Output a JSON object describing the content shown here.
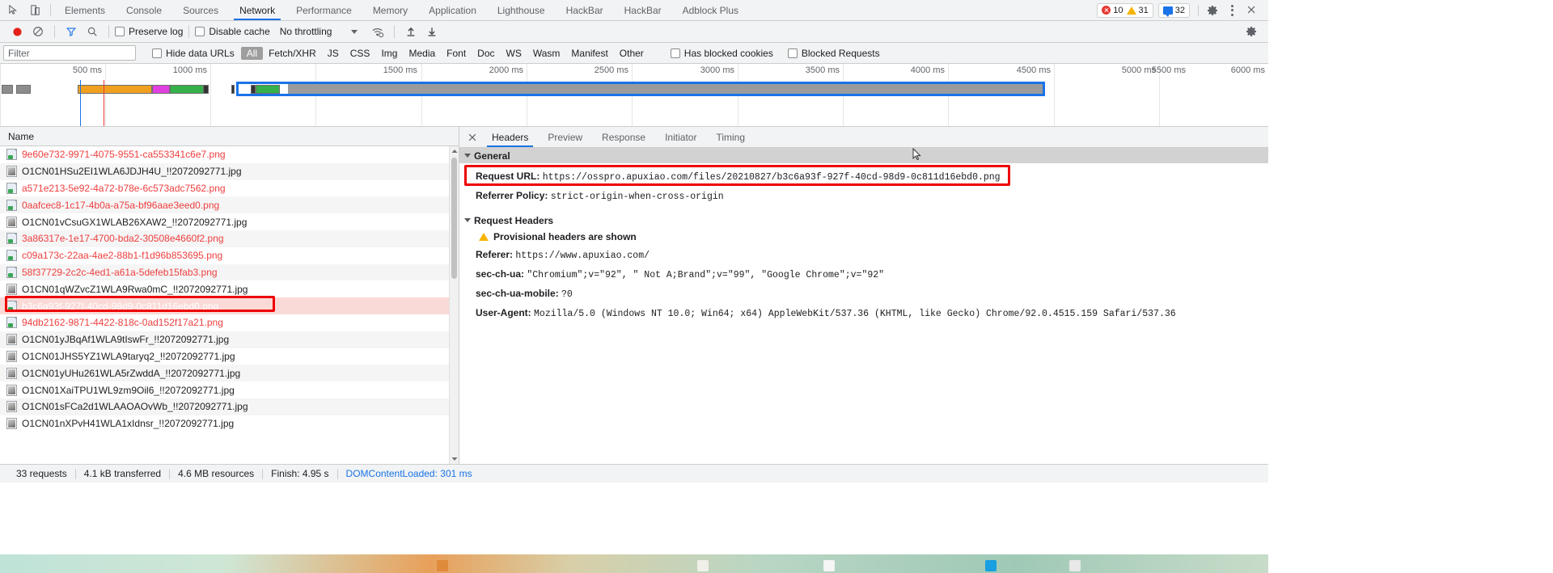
{
  "window": {
    "tabs": [
      {
        "label": "Elements",
        "active": false
      },
      {
        "label": "Console",
        "active": false
      },
      {
        "label": "Sources",
        "active": false
      },
      {
        "label": "Network",
        "active": true
      },
      {
        "label": "Performance",
        "active": false
      },
      {
        "label": "Memory",
        "active": false
      },
      {
        "label": "Application",
        "active": false
      },
      {
        "label": "Lighthouse",
        "active": false
      },
      {
        "label": "HackBar",
        "active": false
      },
      {
        "label": "HackBar",
        "active": false
      },
      {
        "label": "Adblock Plus",
        "active": false
      }
    ],
    "badges": {
      "errors": "10",
      "warnings": "31",
      "messages": "32"
    },
    "icons": {
      "inspect": "inspect-element-icon",
      "device": "device-toolbar-icon",
      "settings": "gear-icon",
      "more": "kebab-menu-icon",
      "close": "close-icon"
    }
  },
  "network_toolbar": {
    "record_title": "Record",
    "clear_title": "Clear",
    "filter_title": "Filter",
    "search_title": "Search",
    "preserve_log_label": "Preserve log",
    "preserve_log_checked": false,
    "disable_cache_label": "Disable cache",
    "disable_cache_checked": false,
    "throttling_value": "No throttling",
    "import_title": "Import HAR",
    "export_title": "Export HAR",
    "settings_title": "Network settings"
  },
  "filter_bar": {
    "placeholder": "Filter",
    "value": "",
    "hide_data_urls_label": "Hide data URLs",
    "hide_data_urls_checked": false,
    "types": [
      {
        "label": "All",
        "selected": true
      },
      {
        "label": "Fetch/XHR",
        "selected": false
      },
      {
        "label": "JS",
        "selected": false
      },
      {
        "label": "CSS",
        "selected": false
      },
      {
        "label": "Img",
        "selected": false
      },
      {
        "label": "Media",
        "selected": false
      },
      {
        "label": "Font",
        "selected": false
      },
      {
        "label": "Doc",
        "selected": false
      },
      {
        "label": "WS",
        "selected": false
      },
      {
        "label": "Wasm",
        "selected": false
      },
      {
        "label": "Manifest",
        "selected": false
      },
      {
        "label": "Other",
        "selected": false
      }
    ],
    "has_blocked_cookies_label": "Has blocked cookies",
    "has_blocked_cookies_checked": false,
    "blocked_requests_label": "Blocked Requests",
    "blocked_requests_checked": false
  },
  "overview": {
    "ticks": [
      "500 ms",
      "1000 ms",
      "1500 ms",
      "2000 ms",
      "2500 ms",
      "3000 ms",
      "3500 ms",
      "4000 ms",
      "4500 ms",
      "5000 ms",
      "5500 ms",
      "6000 ms"
    ],
    "dom_content_loaded_color": "#1a73e8",
    "load_event_color": "#e53935"
  },
  "requests": {
    "column_header": "Name",
    "rows": [
      {
        "name": "9e60e732-9971-4075-9551-ca553341c6e7.png",
        "type": "png",
        "failed": true,
        "selected": false
      },
      {
        "name": "O1CN01HSu2EI1WLA6JDJH4U_!!2072092771.jpg",
        "type": "jpg",
        "failed": false,
        "selected": false
      },
      {
        "name": "a571e213-5e92-4a72-b78e-6c573adc7562.png",
        "type": "png",
        "failed": true,
        "selected": false
      },
      {
        "name": "0aafcec8-1c17-4b0a-a75a-bf96aae3eed0.png",
        "type": "png",
        "failed": true,
        "selected": false
      },
      {
        "name": "O1CN01vCsuGX1WLAB26XAW2_!!2072092771.jpg",
        "type": "jpg",
        "failed": false,
        "selected": false
      },
      {
        "name": "3a86317e-1e17-4700-bda2-30508e4660f2.png",
        "type": "png",
        "failed": true,
        "selected": false
      },
      {
        "name": "c09a173c-22aa-4ae2-88b1-f1d96b853695.png",
        "type": "png",
        "failed": true,
        "selected": false
      },
      {
        "name": "58f37729-2c2c-4ed1-a61a-5defeb15fab3.png",
        "type": "png",
        "failed": true,
        "selected": false
      },
      {
        "name": "O1CN01qWZvcZ1WLA9Rwa0mC_!!2072092771.jpg",
        "type": "jpg",
        "failed": false,
        "selected": false
      },
      {
        "name": "b3c6a93f-927f-40cd-98d9-0c811d16ebd0.png",
        "type": "png",
        "failed": true,
        "selected": true
      },
      {
        "name": "94db2162-9871-4422-818c-0ad152f17a21.png",
        "type": "png",
        "failed": true,
        "selected": false
      },
      {
        "name": "O1CN01yJBqAf1WLA9tIswFr_!!2072092771.jpg",
        "type": "jpg",
        "failed": false,
        "selected": false
      },
      {
        "name": "O1CN01JHS5YZ1WLA9taryq2_!!2072092771.jpg",
        "type": "jpg",
        "failed": false,
        "selected": false
      },
      {
        "name": "O1CN01yUHu261WLA5rZwddA_!!2072092771.jpg",
        "type": "jpg",
        "failed": false,
        "selected": false
      },
      {
        "name": "O1CN01XaiTPU1WL9zm9Oil6_!!2072092771.jpg",
        "type": "jpg",
        "failed": false,
        "selected": false
      },
      {
        "name": "O1CN01sFCa2d1WLAAOAOvWb_!!2072092771.jpg",
        "type": "jpg",
        "failed": false,
        "selected": false
      },
      {
        "name": "O1CN01nXPvH41WLA1xIdnsr_!!2072092771.jpg",
        "type": "jpg",
        "failed": false,
        "selected": false
      }
    ]
  },
  "details": {
    "tabs": [
      {
        "label": "Headers",
        "active": true
      },
      {
        "label": "Preview",
        "active": false
      },
      {
        "label": "Response",
        "active": false
      },
      {
        "label": "Initiator",
        "active": false
      },
      {
        "label": "Timing",
        "active": false
      }
    ],
    "general_title": "General",
    "general": [
      {
        "key": "Request URL:",
        "value": "https://osspro.apuxiao.com/files/20210827/b3c6a93f-927f-40cd-98d9-0c811d16ebd0.png",
        "highlighted": true
      },
      {
        "key": "Referrer Policy:",
        "value": "strict-origin-when-cross-origin",
        "highlighted": false
      }
    ],
    "request_headers_title": "Request Headers",
    "provisional_warning": "Provisional headers are shown",
    "request_headers": [
      {
        "key": "Referer:",
        "value": "https://www.apuxiao.com/"
      },
      {
        "key": "sec-ch-ua:",
        "value": "\"Chromium\";v=\"92\", \" Not A;Brand\";v=\"99\", \"Google Chrome\";v=\"92\""
      },
      {
        "key": "sec-ch-ua-mobile:",
        "value": "?0"
      },
      {
        "key": "User-Agent:",
        "value": "Mozilla/5.0 (Windows NT 10.0; Win64; x64) AppleWebKit/537.36 (KHTML, like Gecko) Chrome/92.0.4515.159 Safari/537.36"
      }
    ]
  },
  "status_bar": {
    "requests": "33 requests",
    "transferred": "4.1 kB transferred",
    "resources": "4.6 MB resources",
    "finish": "Finish: 4.95 s",
    "dom_content_loaded": "DOMContentLoaded: 301 ms"
  },
  "colors": {
    "accent": "#1a73e8",
    "error_text": "#ee3e3e",
    "highlight_box": "#ee0000",
    "selected_row_bg": "#fadad7",
    "toolbar_bg": "#f1f3f4"
  }
}
